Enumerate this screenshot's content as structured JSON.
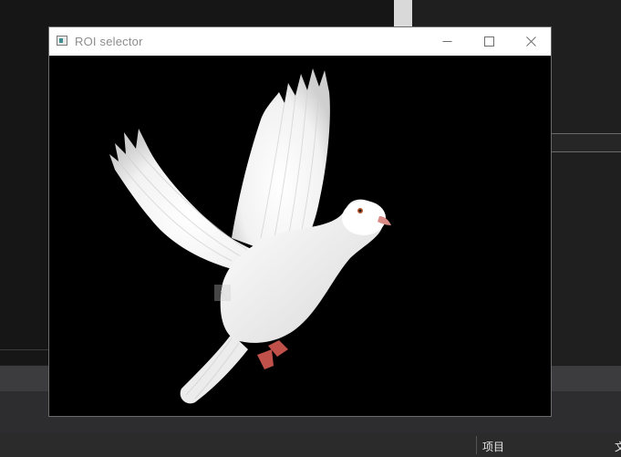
{
  "window": {
    "title": "ROI selector",
    "icons": {
      "app": "app-window-icon",
      "minimize": "minimize-icon",
      "maximize": "maximize-icon",
      "close": "close-icon"
    }
  },
  "canvas": {
    "image_subject": "white-dove-photo",
    "background_color": "#000000",
    "roi_marker_label": "x"
  },
  "ide": {
    "status_item": "项目",
    "status_item_extra": "文"
  },
  "colors": {
    "titlebar_bg": "#ffffff",
    "title_text": "#8d8d8d",
    "ide_dark": "#1e1e1e",
    "ide_bar": "#3c3c3e"
  }
}
